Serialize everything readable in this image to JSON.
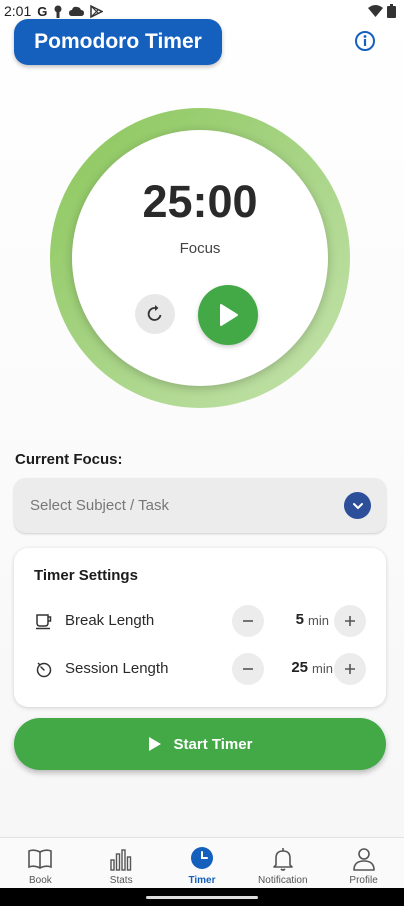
{
  "status_bar": {
    "time": "2:01",
    "left_icons": [
      "google-icon",
      "person-pin-icon",
      "cloud-icon",
      "play-store-icon"
    ],
    "right_icons": [
      "wifi-icon",
      "battery-icon"
    ]
  },
  "header": {
    "title": "Pomodoro Timer",
    "info_icon": "info-icon"
  },
  "timer": {
    "time": "25:00",
    "mode": "Focus",
    "progress": 1.0,
    "colors": {
      "ring": "#a7d485",
      "play": "#43a846"
    }
  },
  "focus": {
    "label": "Current Focus:",
    "placeholder": "Select Subject / Task"
  },
  "settings": {
    "title": "Timer Settings",
    "rows": [
      {
        "label": "Break Length",
        "value": "5",
        "unit": "min",
        "icon": "coffee-cup-icon"
      },
      {
        "label": "Session Length",
        "value": "25",
        "unit": "min",
        "icon": "stopwatch-icon"
      }
    ]
  },
  "start_button": {
    "label": "Start Timer"
  },
  "nav": {
    "items": [
      {
        "label": "Book",
        "icon": "book-icon",
        "active": false
      },
      {
        "label": "Stats",
        "icon": "bar-chart-icon",
        "active": false
      },
      {
        "label": "Timer",
        "icon": "clock-icon",
        "active": true
      },
      {
        "label": "Notification",
        "icon": "bell-icon",
        "active": false
      },
      {
        "label": "Profile",
        "icon": "person-icon",
        "active": false
      }
    ]
  },
  "colors": {
    "primary": "#1560bd",
    "green": "#43a846",
    "accent_dark": "#2d4f9a"
  }
}
